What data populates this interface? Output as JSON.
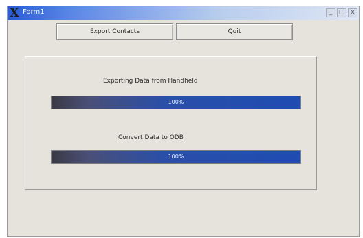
{
  "window": {
    "title": "Form1",
    "icon": "x-app-icon",
    "controls": [
      "_",
      "□",
      "x"
    ]
  },
  "toolbar": {
    "export_label": "Export Contacts",
    "quit_label": "Quit"
  },
  "progress": {
    "step1": {
      "label": "Exporting Data from Handheld",
      "percent_text": "100%",
      "percent": 100
    },
    "step2": {
      "label": "Convert Data to ODB",
      "percent_text": "100%",
      "percent": 100
    }
  }
}
